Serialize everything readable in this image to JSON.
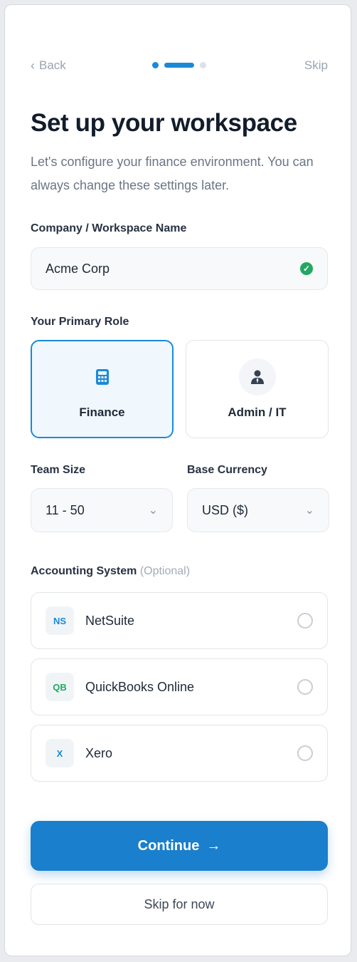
{
  "nav": {
    "back_label": "Back",
    "skip_label": "Skip",
    "progress": {
      "current_step": 2,
      "total_steps": 3
    }
  },
  "header": {
    "title": "Set up your workspace",
    "subtitle": "Let's configure your finance environment. You can always change these settings later."
  },
  "company": {
    "label": "Company / Workspace Name",
    "value": "Acme Corp",
    "valid": true
  },
  "role": {
    "label": "Your Primary Role",
    "options": [
      {
        "label": "Finance",
        "icon": "calculator-icon",
        "selected": true
      },
      {
        "label": "Admin / IT",
        "icon": "user-admin-icon",
        "selected": false
      }
    ]
  },
  "team_size": {
    "label": "Team Size",
    "value": "11 - 50"
  },
  "currency": {
    "label": "Base Currency",
    "value": "USD ($)"
  },
  "accounting": {
    "label": "Accounting System",
    "optional_label": "(Optional)",
    "options": [
      {
        "badge": "NS",
        "label": "NetSuite",
        "badge_color": "#1b8ad6",
        "selected": false
      },
      {
        "badge": "QB",
        "label": "QuickBooks Online",
        "badge_color": "#22a861",
        "selected": false
      },
      {
        "badge": "X",
        "label": "Xero",
        "badge_color": "#1b8ad6",
        "selected": false
      }
    ]
  },
  "actions": {
    "continue_label": "Continue",
    "skip_for_now_label": "Skip for now"
  },
  "colors": {
    "accent": "#1b8ad6",
    "success": "#22a861"
  }
}
